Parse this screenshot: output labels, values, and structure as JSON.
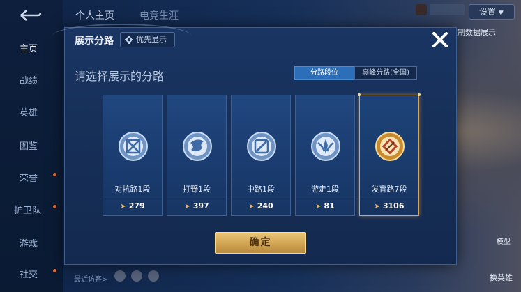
{
  "top": {
    "tabs": [
      "个人主页",
      "电竞生涯"
    ],
    "settings_label": "设置",
    "data_show_label": "定制数据展示",
    "model_label": "模型",
    "switch_hero_label": "换英雄",
    "recent_visitors_label": "最近访客>"
  },
  "sidebar": {
    "items": [
      {
        "label": "主页",
        "active": true
      },
      {
        "label": "战绩"
      },
      {
        "label": "英雄"
      },
      {
        "label": "图鉴"
      },
      {
        "label": "荣誉"
      },
      {
        "label": "护卫队"
      },
      {
        "label": "游戏"
      },
      {
        "label": "社交"
      }
    ]
  },
  "dialog": {
    "title": "展示分路",
    "priority_label": "优先显示",
    "subtitle": "请选择展示的分路",
    "segments": [
      "分路段位",
      "巅峰分路(全国)"
    ],
    "active_segment": 0,
    "confirm_label": "确定",
    "lanes": [
      {
        "name": "对抗路1段",
        "score": "279",
        "icon": "clash-lane-emblem",
        "selected": false
      },
      {
        "name": "打野1段",
        "score": "397",
        "icon": "jungle-emblem",
        "selected": false
      },
      {
        "name": "中路1段",
        "score": "240",
        "icon": "mid-lane-emblem",
        "selected": false
      },
      {
        "name": "游走1段",
        "score": "81",
        "icon": "roam-emblem",
        "selected": false
      },
      {
        "name": "发育路7段",
        "score": "3106",
        "icon": "farm-lane-emblem",
        "selected": true
      }
    ]
  },
  "colors": {
    "accent_gold": "#d8a55c",
    "active_segment": "#2c6fb8",
    "dialog_bg": "#163059"
  }
}
